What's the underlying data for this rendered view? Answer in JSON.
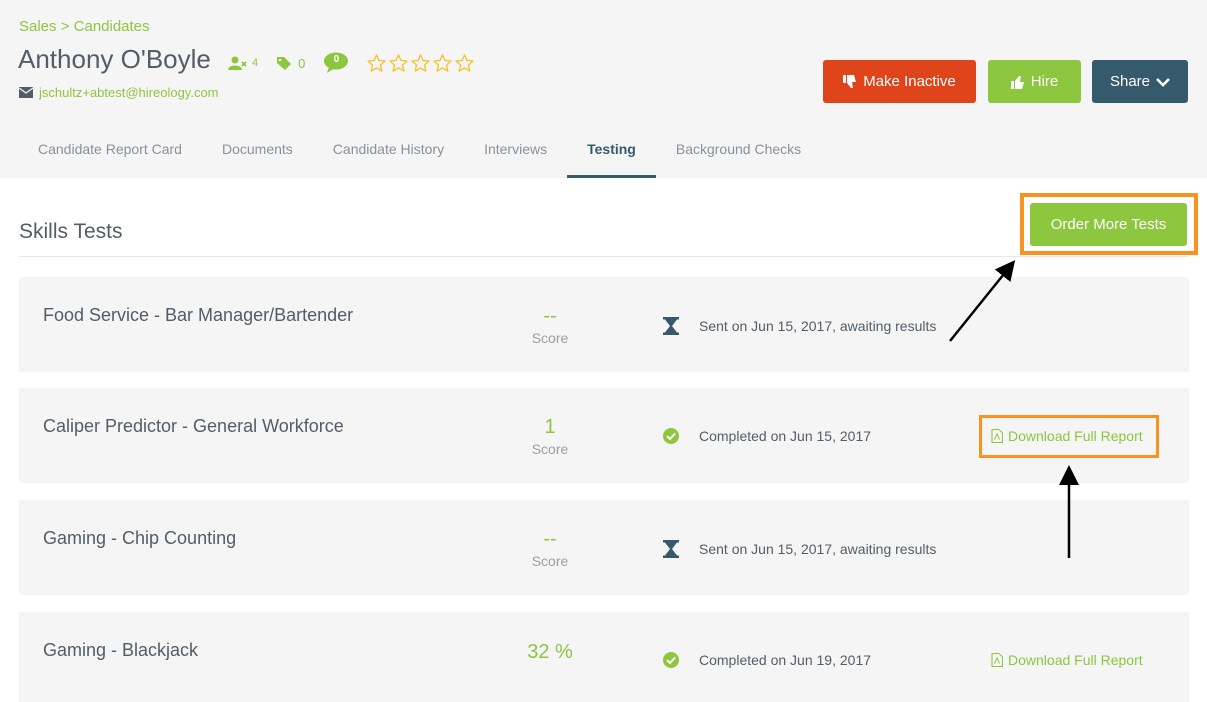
{
  "breadcrumb": {
    "section": "Sales",
    "separator": ">",
    "page": "Candidates"
  },
  "candidate": {
    "name": "Anthony O'Boyle",
    "team_count": "4",
    "tag_count": "0",
    "comment_count": "0",
    "email": "jschultz+abtest@hireology.com",
    "rating": 0,
    "rating_max": 5
  },
  "actions": {
    "make_inactive": "Make Inactive",
    "hire": "Hire",
    "share": "Share"
  },
  "tabs": [
    {
      "label": "Candidate Report Card",
      "active": false
    },
    {
      "label": "Documents",
      "active": false
    },
    {
      "label": "Candidate History",
      "active": false
    },
    {
      "label": "Interviews",
      "active": false
    },
    {
      "label": "Testing",
      "active": true
    },
    {
      "label": "Background Checks",
      "active": false
    }
  ],
  "skills": {
    "title": "Skills Tests",
    "order_button": "Order More Tests",
    "score_label": "Score",
    "tests": [
      {
        "name": "Food Service - Bar Manager/Bartender",
        "score": "--",
        "show_score_label": true,
        "status": "pending",
        "status_text": "Sent on Jun 15, 2017, awaiting results",
        "download": ""
      },
      {
        "name": "Caliper Predictor - General Workforce",
        "score": "1",
        "show_score_label": true,
        "status": "complete",
        "status_text": "Completed on Jun 15, 2017",
        "download": "Download Full Report"
      },
      {
        "name": "Gaming - Chip Counting",
        "score": "--",
        "show_score_label": true,
        "status": "pending",
        "status_text": "Sent on Jun 15, 2017, awaiting results",
        "download": ""
      },
      {
        "name": "Gaming - Blackjack",
        "score": "32 %",
        "show_score_label": false,
        "status": "complete",
        "status_text": "Completed on Jun 19, 2017",
        "download": "Download Full Report"
      }
    ]
  },
  "colors": {
    "green": "#8dc63f",
    "red": "#e0441b",
    "navy": "#355a6b",
    "highlight": "#f7931e"
  }
}
